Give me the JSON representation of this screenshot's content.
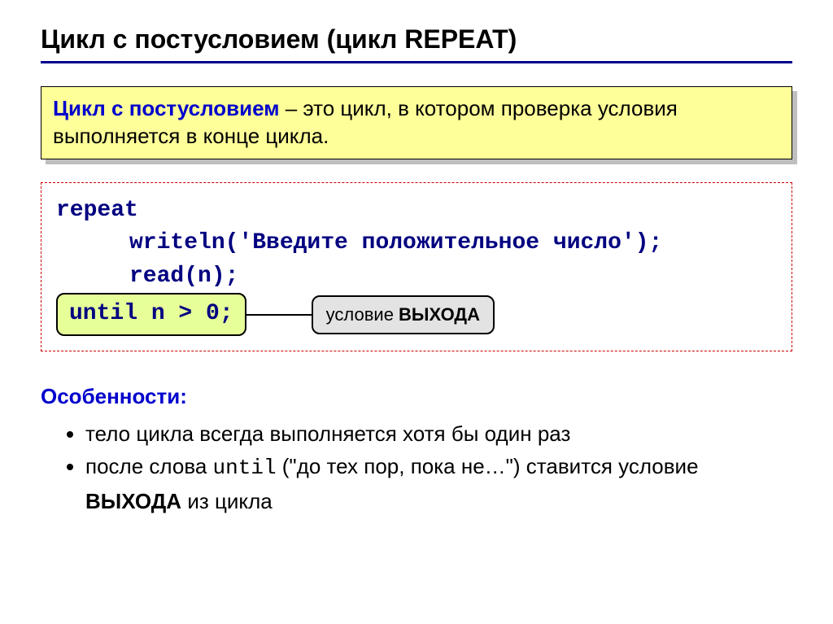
{
  "title": "Цикл с постусловием (цикл REPEAT)",
  "definition": {
    "term": "Цикл с постусловием",
    "rest": " – это цикл, в котором проверка условия выполняется в конце цикла."
  },
  "code": {
    "l1": "repeat",
    "l2": "writeln('Введите положительное число');",
    "l3": "read(n);",
    "until": "until n > 0;"
  },
  "callout": {
    "prefix": "условие ",
    "strong": "ВЫХОДА"
  },
  "features_title": "Особенности:",
  "features": {
    "f1": "тело цикла всегда выполняется хотя бы один раз",
    "f2_a": "после слова ",
    "f2_code": "until",
    "f2_b": " (\"до тех пор, пока не…\") ставится условие ",
    "f2_strong": "ВЫХОДА",
    "f2_c": " из цикла"
  }
}
